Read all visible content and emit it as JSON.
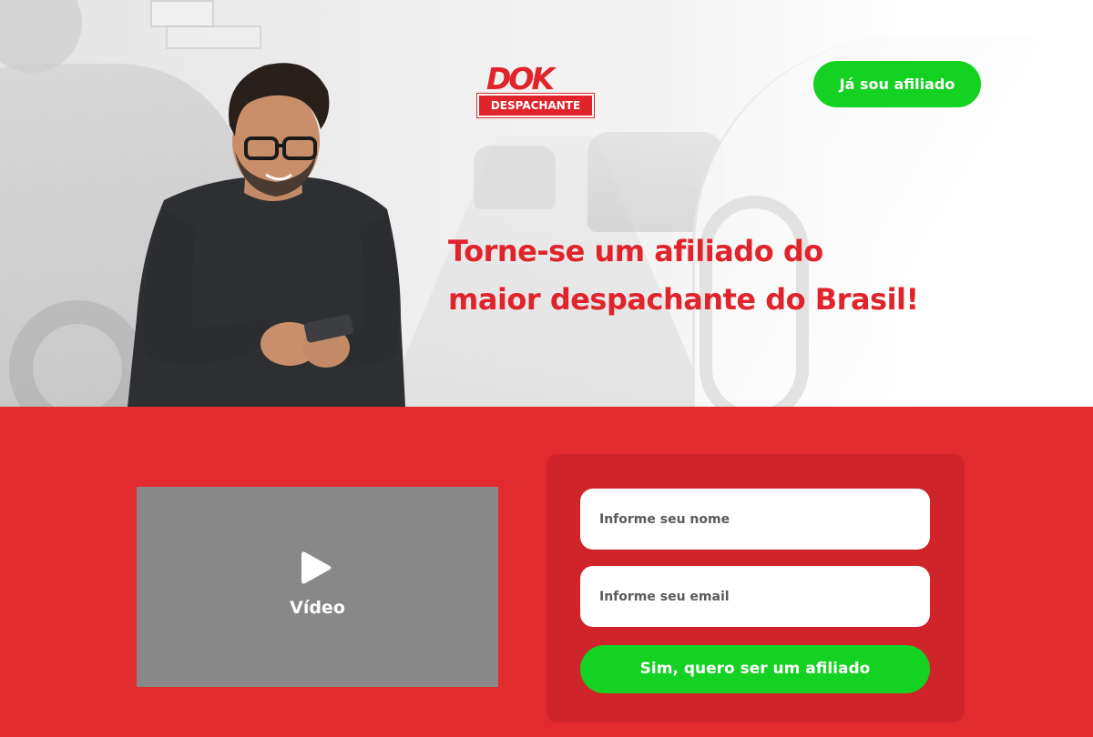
{
  "logo": {
    "top_text": "DOK",
    "bottom_text": "DESPACHANTE"
  },
  "header": {
    "affiliate_login_label": "Já sou afiliado"
  },
  "hero": {
    "headline_line1": "Torne-se um afiliado do",
    "headline_line2": "maior despachante do Brasil!"
  },
  "video": {
    "label": "Vídeo",
    "icon": "play-icon"
  },
  "form": {
    "name_placeholder": "Informe seu nome",
    "name_value": "",
    "email_placeholder": "Informe seu email",
    "email_value": "",
    "submit_label": "Sim, quero ser um afiliado"
  },
  "colors": {
    "brand_red": "#e22b2f",
    "panel_red": "#cf2429",
    "accent_green": "#13d221",
    "video_gray": "#888888"
  }
}
